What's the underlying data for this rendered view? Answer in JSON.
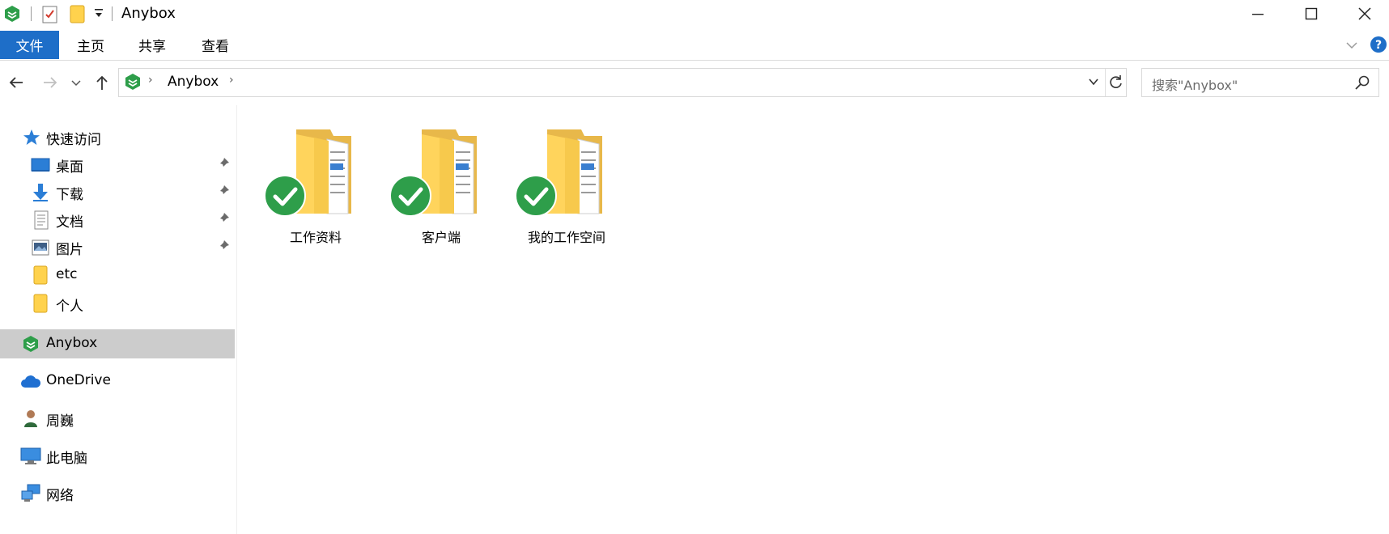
{
  "window": {
    "title": "Anybox",
    "controls": [
      "minimize-icon",
      "maximize-icon",
      "close-icon"
    ]
  },
  "ribbon": {
    "tabs": [
      {
        "label": "文件",
        "active": true
      },
      {
        "label": "主页"
      },
      {
        "label": "共享"
      },
      {
        "label": "查看"
      }
    ],
    "accent": "#1e6ec8"
  },
  "address": {
    "crumbs": [
      "Anybox"
    ],
    "search_placeholder": "搜索\"Anybox\""
  },
  "sidebar": {
    "quick_access": {
      "label": "快速访问",
      "items": [
        {
          "label": "桌面",
          "icon": "desktop-icon",
          "pinned": true
        },
        {
          "label": "下载",
          "icon": "download-icon",
          "pinned": true
        },
        {
          "label": "文档",
          "icon": "document-icon",
          "pinned": true
        },
        {
          "label": "图片",
          "icon": "pictures-icon",
          "pinned": true
        },
        {
          "label": "etc",
          "icon": "folder-icon",
          "pinned": false
        },
        {
          "label": "个人",
          "icon": "folder-icon",
          "pinned": false
        }
      ]
    },
    "roots": [
      {
        "label": "Anybox",
        "icon": "anybox-icon",
        "selected": true
      },
      {
        "label": "OneDrive",
        "icon": "cloud-icon"
      },
      {
        "label": "周巍",
        "icon": "user-icon"
      },
      {
        "label": "此电脑",
        "icon": "computer-icon"
      },
      {
        "label": "网络",
        "icon": "network-icon"
      }
    ]
  },
  "content": {
    "folders": [
      {
        "name": "工作资料",
        "status": "synced"
      },
      {
        "name": "客户端",
        "status": "synced"
      },
      {
        "name": "我的工作空间",
        "status": "synced"
      }
    ],
    "status_color": "#2e9e4a"
  }
}
